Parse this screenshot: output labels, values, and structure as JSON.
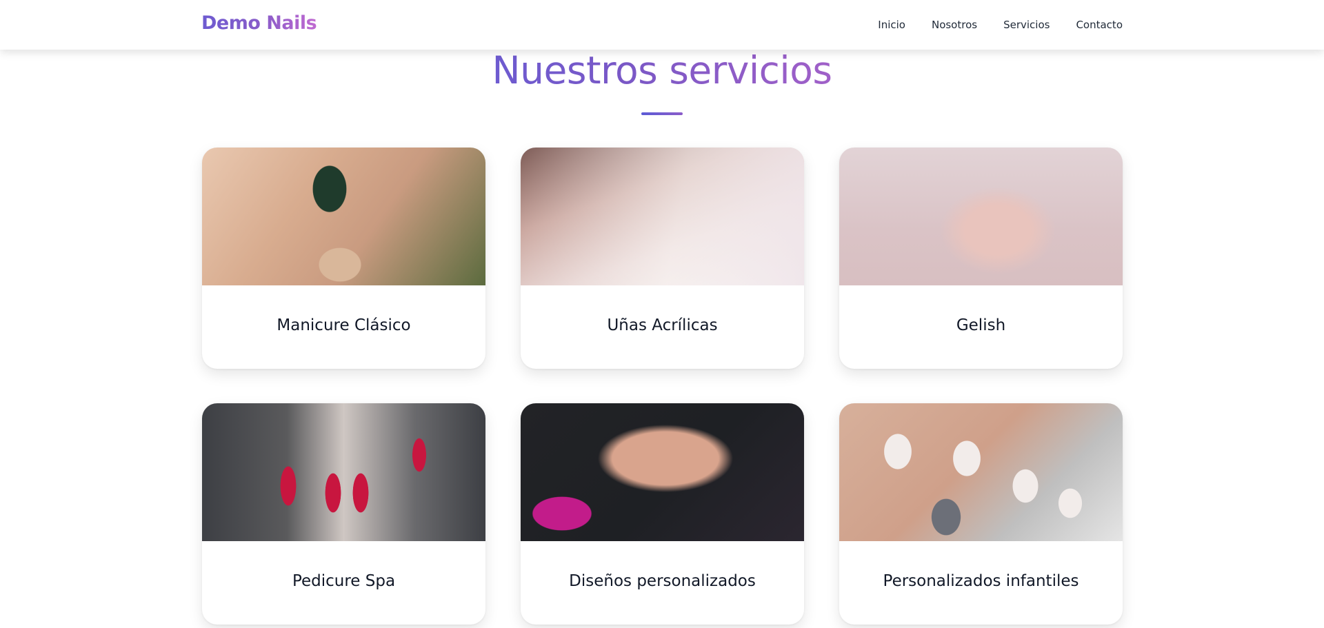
{
  "navbar": {
    "brand": "Demo Nails",
    "links": [
      "Inicio",
      "Nosotros",
      "Servicios",
      "Contacto"
    ]
  },
  "section": {
    "title": "Nuestros servicios"
  },
  "services": [
    {
      "title": "Manicure Clásico"
    },
    {
      "title": "Uñas Acrílicas"
    },
    {
      "title": "Gelish"
    },
    {
      "title": "Pedicure Spa"
    },
    {
      "title": "Diseños personalizados"
    },
    {
      "title": "Personalizados infantiles"
    }
  ],
  "colors": {
    "accent": "#6d5bd0",
    "accent_secondary": "#a060c8"
  }
}
